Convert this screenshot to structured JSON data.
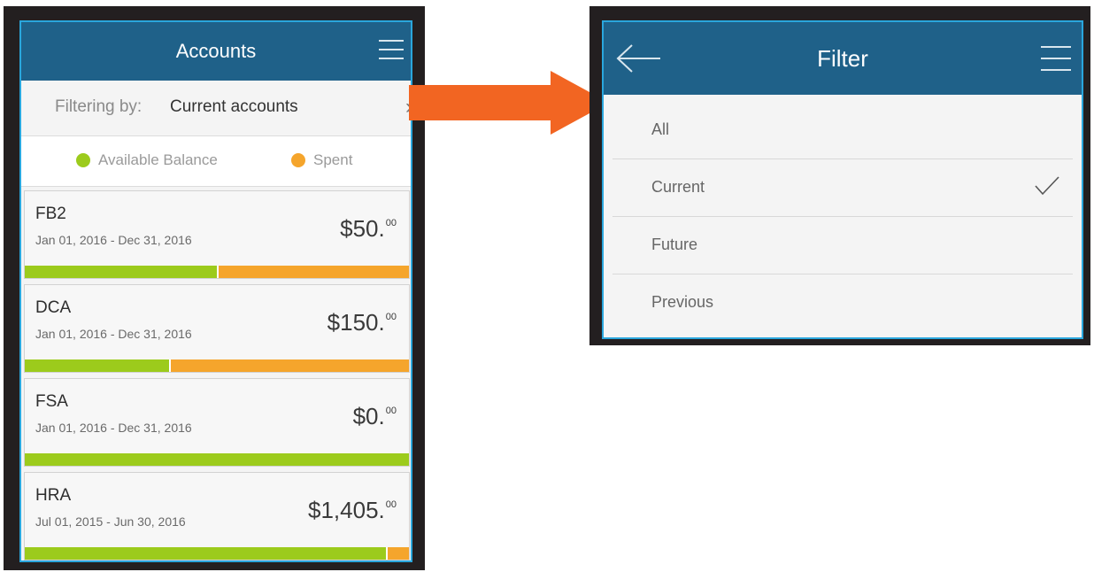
{
  "accounts_screen": {
    "title": "Accounts",
    "filter_label": "Filtering by:",
    "filter_value": "Current accounts",
    "legend": {
      "available": "Available Balance",
      "spent": "Spent",
      "available_color": "#9ccb1c",
      "spent_color": "#f5a52c"
    },
    "accounts": [
      {
        "name": "FB2",
        "dates": "Jan 01, 2016 - Dec 31, 2016",
        "amount": "$50.",
        "cents": "00",
        "available_fraction": 0.5
      },
      {
        "name": "DCA",
        "dates": "Jan 01, 2016 - Dec 31, 2016",
        "amount": "$150.",
        "cents": "00",
        "available_fraction": 0.375
      },
      {
        "name": "FSA",
        "dates": "Jan 01, 2016 - Dec 31, 2016",
        "amount": "$0.",
        "cents": "00",
        "available_fraction": 1.0
      },
      {
        "name": "HRA",
        "dates": "Jul 01, 2015 - Jun 30, 2016",
        "amount": "$1,405.",
        "cents": "00",
        "available_fraction": 0.94
      }
    ]
  },
  "filter_screen": {
    "title": "Filter",
    "options": [
      {
        "label": "All",
        "selected": false
      },
      {
        "label": "Current",
        "selected": true
      },
      {
        "label": "Future",
        "selected": false
      },
      {
        "label": "Previous",
        "selected": false
      }
    ]
  },
  "icons": {
    "menu": "hamburger-icon",
    "back": "back-arrow-icon",
    "chevron": "chevron-right-icon",
    "check": "checkmark-icon",
    "transition": "flow-arrow-icon"
  },
  "colors": {
    "nav_bar": "#1f6189",
    "screen_border": "#2aa6dc",
    "arrow": "#f26522"
  }
}
